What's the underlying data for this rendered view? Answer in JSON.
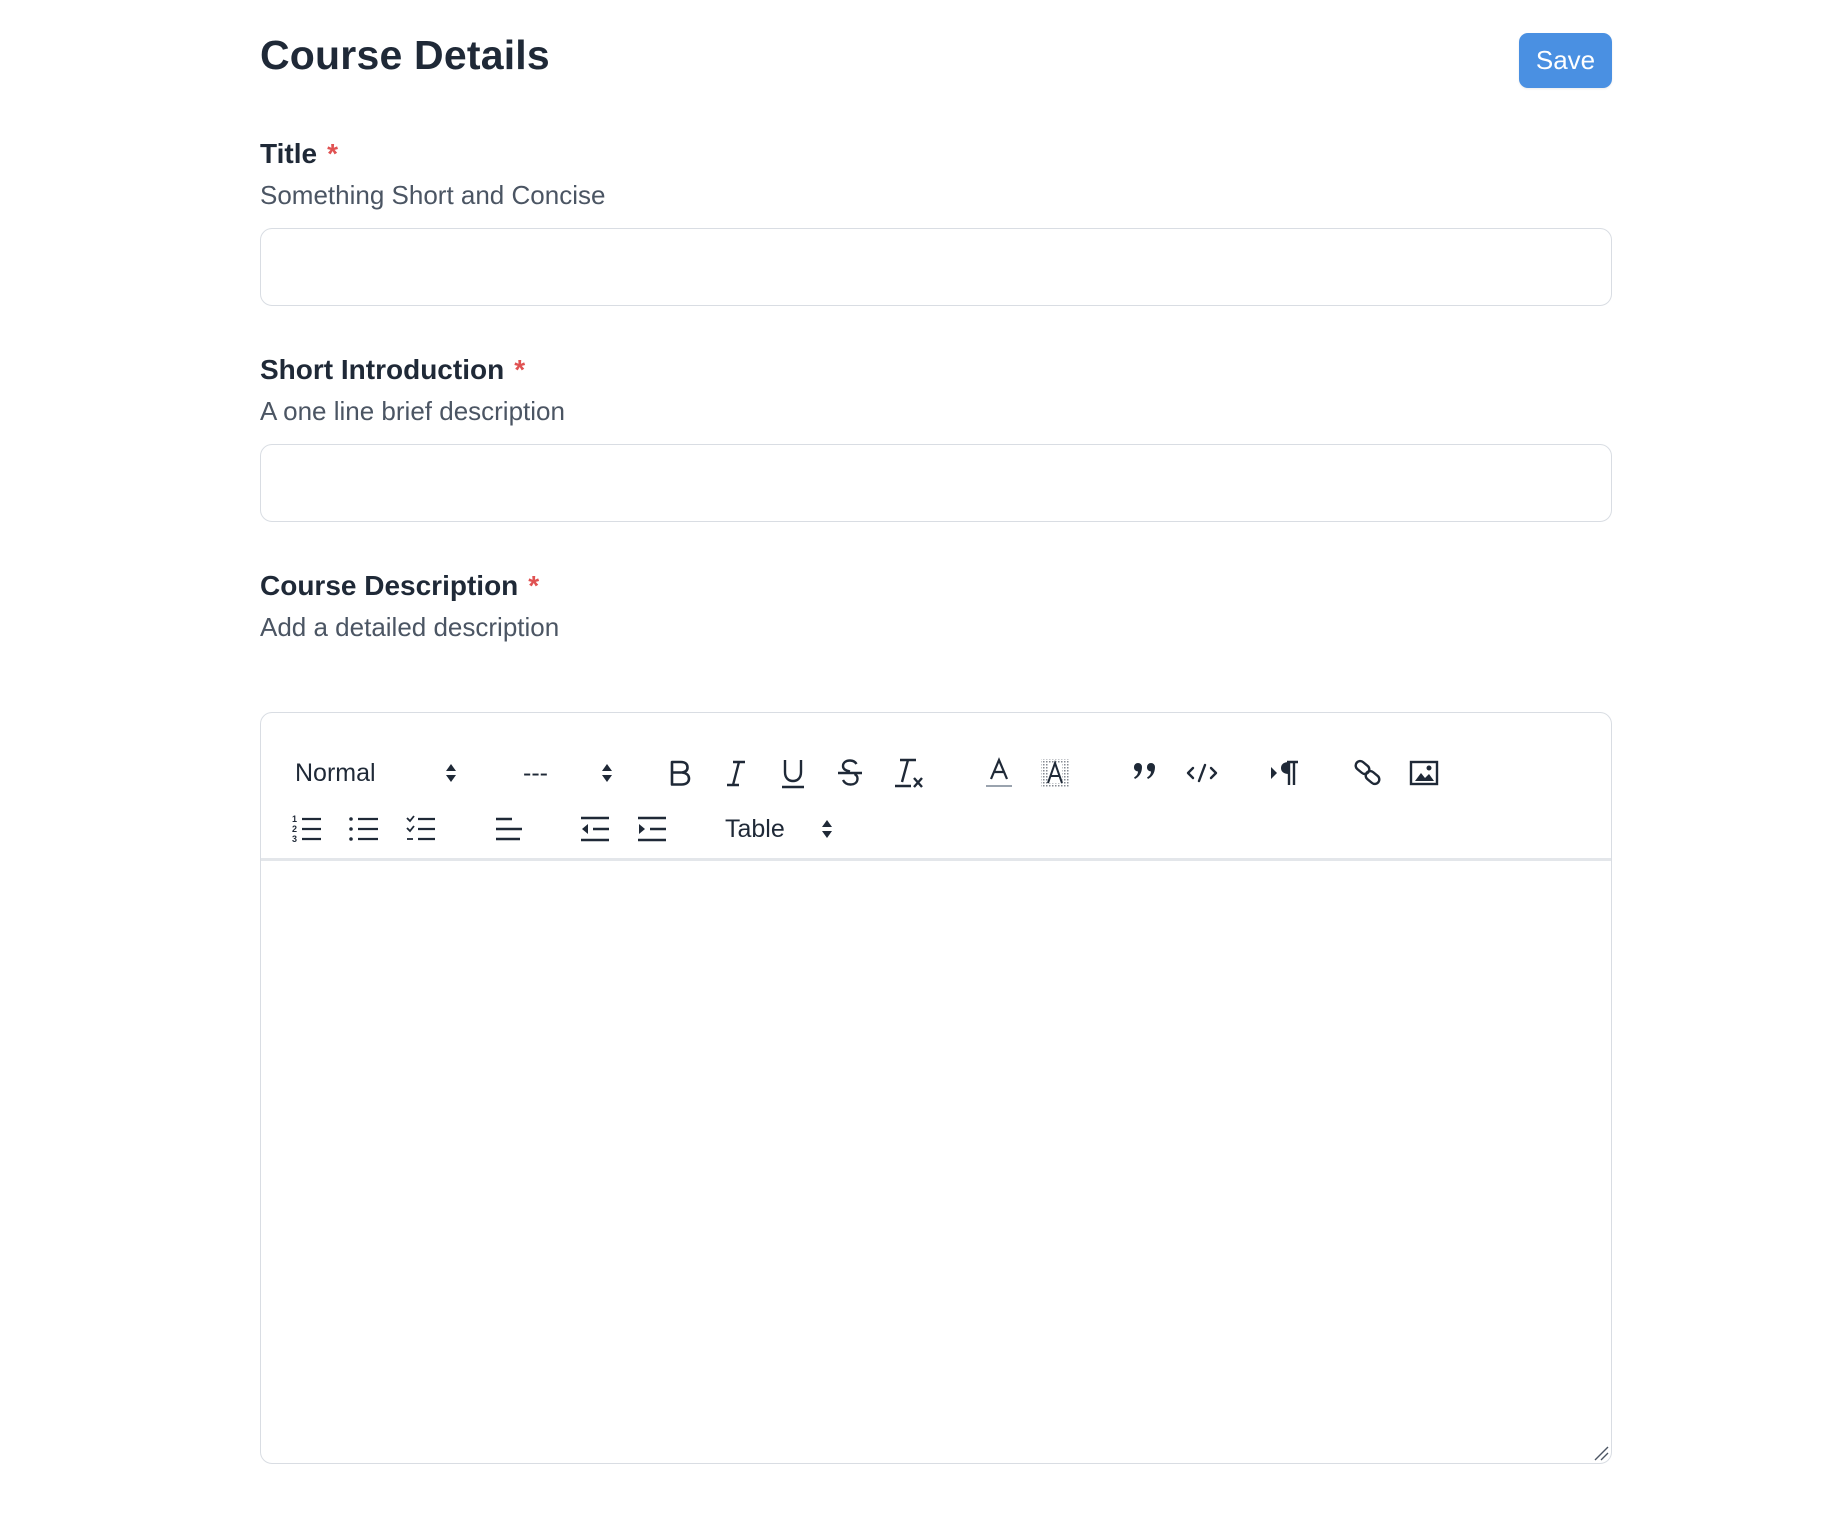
{
  "page": {
    "title": "Course Details",
    "save_label": "Save"
  },
  "fields": {
    "title": {
      "label": "Title",
      "required_mark": "*",
      "hint": "Something Short and Concise",
      "value": "",
      "placeholder": ""
    },
    "short_intro": {
      "label": "Short Introduction",
      "required_mark": "*",
      "hint": "A one line brief description",
      "value": "",
      "placeholder": ""
    },
    "description": {
      "label": "Course Description",
      "required_mark": "*",
      "hint": "Add a detailed description",
      "value": ""
    }
  },
  "toolbar": {
    "heading_select": "Normal",
    "font_size_select": "---",
    "table_select": "Table",
    "icons": [
      "bold-icon",
      "italic-icon",
      "underline-icon",
      "strikethrough-icon",
      "clear-format-icon",
      "text-color-icon",
      "background-color-icon",
      "blockquote-icon",
      "code-block-icon",
      "text-direction-icon",
      "link-icon",
      "image-icon",
      "ordered-list-icon",
      "bullet-list-icon",
      "check-list-icon",
      "align-left-icon",
      "outdent-icon",
      "indent-icon"
    ]
  },
  "colors": {
    "accent": "#4a90e2",
    "required": "#e05252",
    "text": "#1f2937",
    "hint": "#4b5563",
    "border": "#d9dde3"
  }
}
